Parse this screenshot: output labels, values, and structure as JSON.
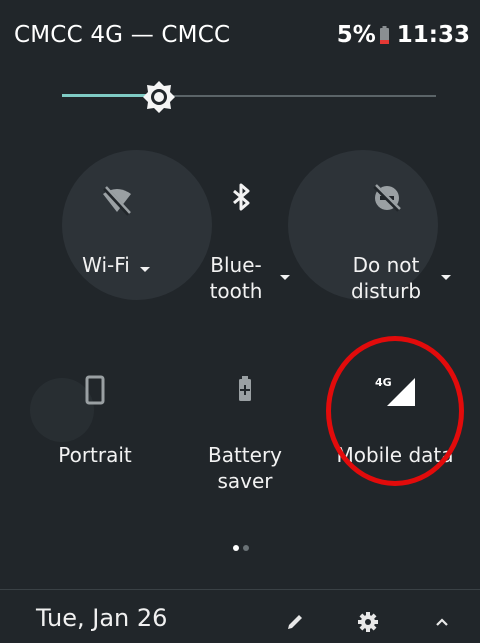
{
  "status_bar": {
    "carrier": "CMCC 4G — CMCC",
    "battery_percent": "5%",
    "time": "11:33"
  },
  "brightness": {
    "level": 0.26
  },
  "tiles": [
    {
      "name": "wifi",
      "label": "Wi-Fi",
      "icon": "wifi-off-icon",
      "has_dropdown": true
    },
    {
      "name": "bluetooth",
      "label": "Blue-\ntooth",
      "icon": "bluetooth-icon",
      "has_dropdown": true
    },
    {
      "name": "do-not-disturb",
      "label": "Do not\ndisturb",
      "icon": "do-not-disturb-off-icon",
      "has_dropdown": true
    },
    {
      "name": "portrait",
      "label": "Portrait",
      "icon": "portrait-icon",
      "has_dropdown": false
    },
    {
      "name": "battery-saver",
      "label": "Battery\nsaver",
      "icon": "battery-saver-icon",
      "has_dropdown": false
    },
    {
      "name": "mobile-data",
      "label": "Mobile data",
      "icon": "mobile-data-4g-icon",
      "badge": "4G",
      "has_dropdown": false
    }
  ],
  "pager": {
    "pages": 2,
    "current": 1
  },
  "footer": {
    "date": "Tue, Jan 26",
    "edit_icon": "pencil-icon",
    "settings_icon": "gear-icon",
    "collapse_icon": "chevron-up-icon"
  },
  "colors": {
    "background": "#21262a",
    "accent": "#7fcbc4",
    "highlight": "#e20b0b"
  }
}
